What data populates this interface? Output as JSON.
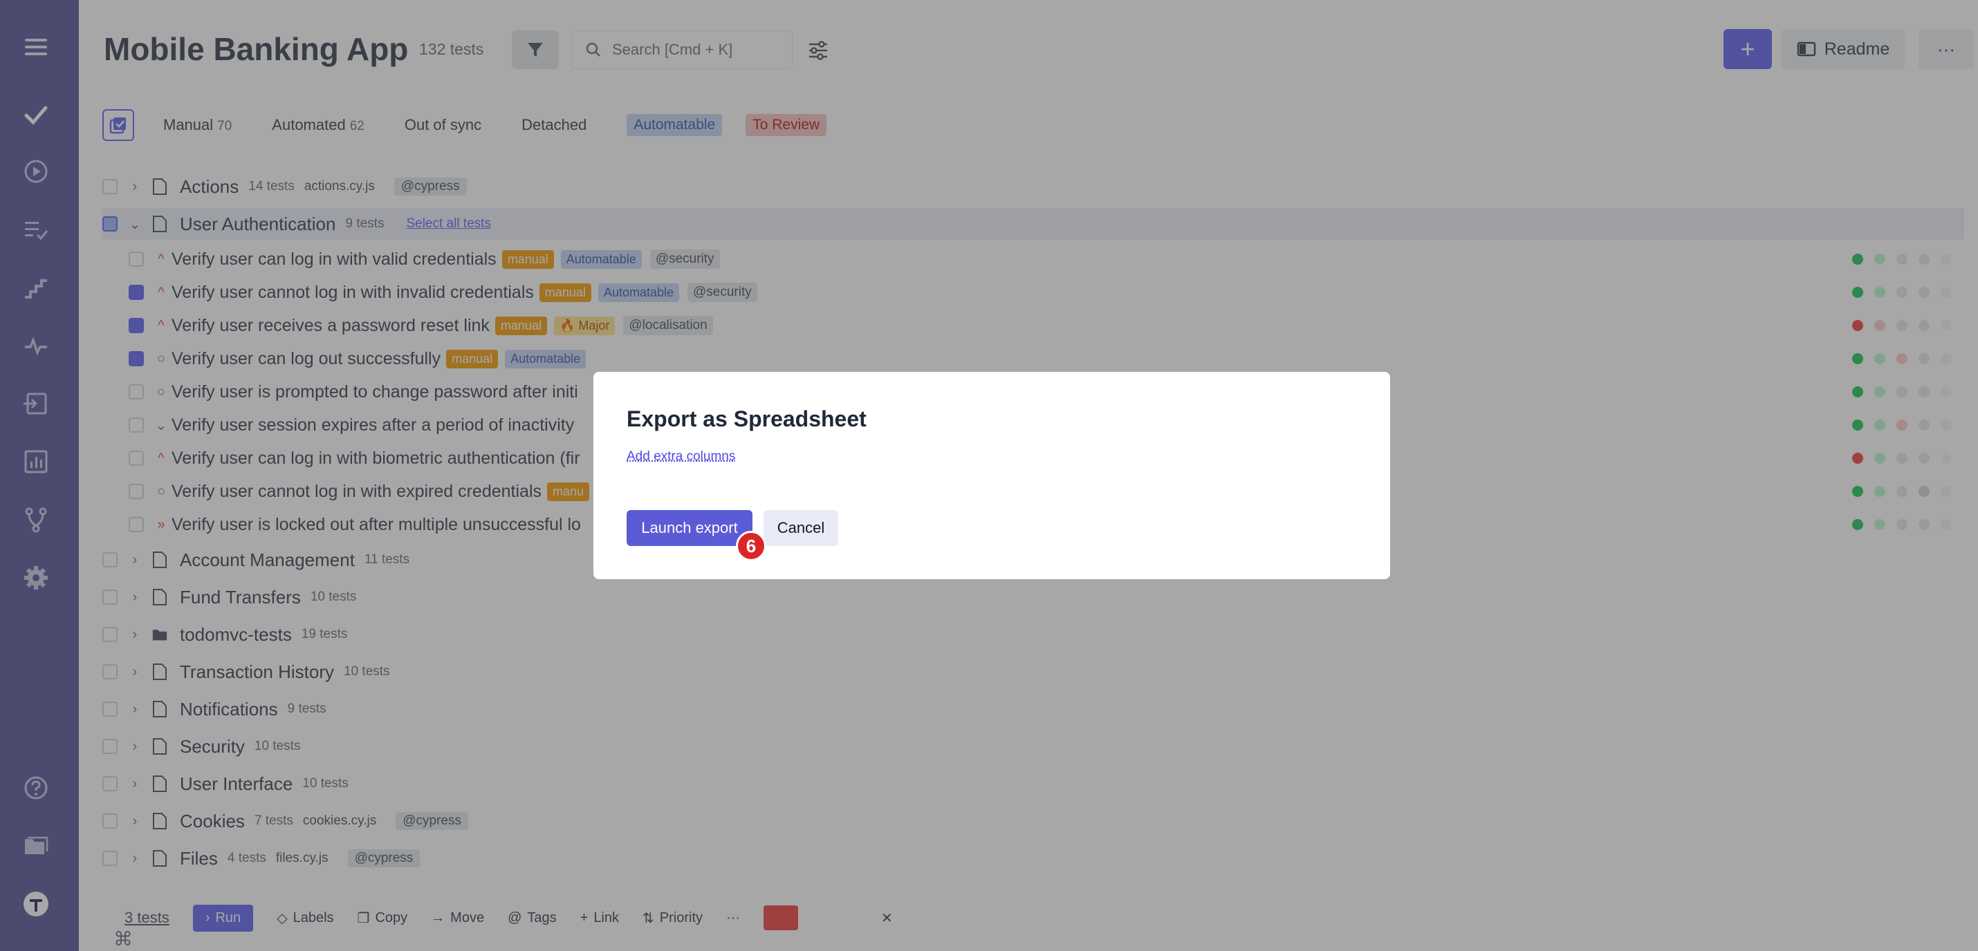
{
  "header": {
    "title": "Mobile Banking App",
    "test_count": "132 tests",
    "search_placeholder": "Search [Cmd + K]",
    "add_label": "+",
    "readme_label": "Readme",
    "more_label": "···"
  },
  "tabs": [
    {
      "label": "Manual",
      "count": "70"
    },
    {
      "label": "Automated",
      "count": "62"
    },
    {
      "label": "Out of sync",
      "count": ""
    },
    {
      "label": "Detached",
      "count": ""
    }
  ],
  "tab_badges": {
    "automatable": "Automatable",
    "to_review": "To Review"
  },
  "suites": [
    {
      "name": "Actions",
      "count": "14 tests",
      "file": "actions.cy.js",
      "tag": "@cypress"
    },
    {
      "name": "User Authentication",
      "count": "9 tests",
      "select_all": "Select all tests"
    },
    {
      "name": "Account Management",
      "count": "11 tests"
    },
    {
      "name": "Fund Transfers",
      "count": "10 tests"
    },
    {
      "name": "todomvc-tests",
      "count": "19 tests"
    },
    {
      "name": "Transaction History",
      "count": "10 tests"
    },
    {
      "name": "Notifications",
      "count": "9 tests"
    },
    {
      "name": "Security",
      "count": "10 tests"
    },
    {
      "name": "User Interface",
      "count": "10 tests"
    },
    {
      "name": "Cookies",
      "count": "7 tests",
      "file": "cookies.cy.js",
      "tag": "@cypress"
    },
    {
      "name": "Files",
      "count": "4 tests",
      "file": "files.cy.js",
      "tag": "@cypress"
    }
  ],
  "tests": [
    {
      "name": "Verify user can log in with valid credentials",
      "manual": "manual",
      "auto": "Automatable",
      "tag": "@security"
    },
    {
      "name": "Verify user cannot log in with invalid credentials",
      "manual": "manual",
      "auto": "Automatable",
      "tag": "@security"
    },
    {
      "name": "Verify user receives a password reset link",
      "manual": "manual",
      "major": "🔥 Major",
      "tag": "@localisation"
    },
    {
      "name": "Verify user can log out successfully",
      "manual": "manual",
      "auto": "Automatable"
    },
    {
      "name": "Verify user is prompted to change password after initi"
    },
    {
      "name": "Verify user session expires after a period of inactivity"
    },
    {
      "name": "Verify user can log in with biometric authentication (fir"
    },
    {
      "name": "Verify user cannot log in with expired credentials",
      "manual": "manu"
    },
    {
      "name": "Verify user is locked out after multiple unsuccessful lo"
    }
  ],
  "toolbar": {
    "count": "3 tests",
    "run": "Run",
    "labels": "Labels",
    "copy": "Copy",
    "move": "Move",
    "tags": "Tags",
    "link": "Link",
    "priority": "Priority",
    "more": "···",
    "close": "✕"
  },
  "modal": {
    "title": "Export as Spreadsheet",
    "link": "Add extra columns",
    "launch": "Launch export",
    "cancel": "Cancel",
    "step": "6"
  }
}
